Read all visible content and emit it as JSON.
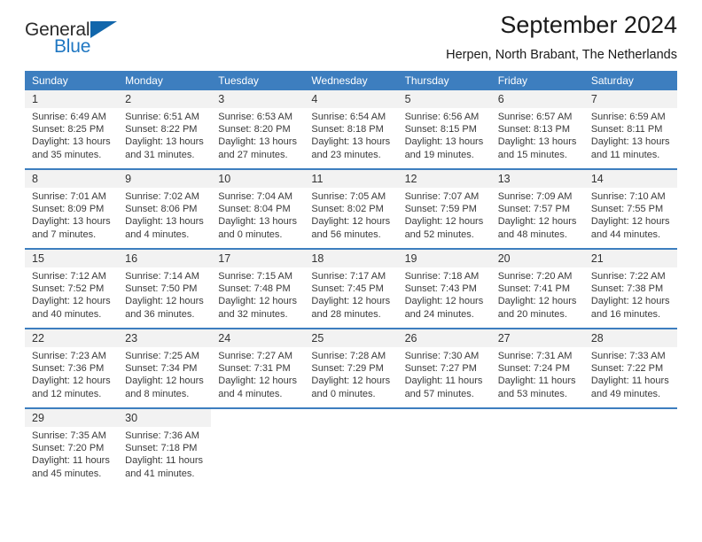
{
  "logo": {
    "word1": "General",
    "word2": "Blue",
    "triangle_color": "#1166ab",
    "blue_color": "#1f77c2"
  },
  "header": {
    "title": "September 2024",
    "subtitle": "Herpen, North Brabant, The Netherlands"
  },
  "theme": {
    "header_blue": "#3d7ebf",
    "day_number_band": "#f2f2f2",
    "text": "#3a3a3a"
  },
  "calendar": {
    "day_headers": [
      "Sunday",
      "Monday",
      "Tuesday",
      "Wednesday",
      "Thursday",
      "Friday",
      "Saturday"
    ],
    "weeks": [
      [
        {
          "day": "1",
          "sunrise": "Sunrise: 6:49 AM",
          "sunset": "Sunset: 8:25 PM",
          "daylight1": "Daylight: 13 hours",
          "daylight2": "and 35 minutes."
        },
        {
          "day": "2",
          "sunrise": "Sunrise: 6:51 AM",
          "sunset": "Sunset: 8:22 PM",
          "daylight1": "Daylight: 13 hours",
          "daylight2": "and 31 minutes."
        },
        {
          "day": "3",
          "sunrise": "Sunrise: 6:53 AM",
          "sunset": "Sunset: 8:20 PM",
          "daylight1": "Daylight: 13 hours",
          "daylight2": "and 27 minutes."
        },
        {
          "day": "4",
          "sunrise": "Sunrise: 6:54 AM",
          "sunset": "Sunset: 8:18 PM",
          "daylight1": "Daylight: 13 hours",
          "daylight2": "and 23 minutes."
        },
        {
          "day": "5",
          "sunrise": "Sunrise: 6:56 AM",
          "sunset": "Sunset: 8:15 PM",
          "daylight1": "Daylight: 13 hours",
          "daylight2": "and 19 minutes."
        },
        {
          "day": "6",
          "sunrise": "Sunrise: 6:57 AM",
          "sunset": "Sunset: 8:13 PM",
          "daylight1": "Daylight: 13 hours",
          "daylight2": "and 15 minutes."
        },
        {
          "day": "7",
          "sunrise": "Sunrise: 6:59 AM",
          "sunset": "Sunset: 8:11 PM",
          "daylight1": "Daylight: 13 hours",
          "daylight2": "and 11 minutes."
        }
      ],
      [
        {
          "day": "8",
          "sunrise": "Sunrise: 7:01 AM",
          "sunset": "Sunset: 8:09 PM",
          "daylight1": "Daylight: 13 hours",
          "daylight2": "and 7 minutes."
        },
        {
          "day": "9",
          "sunrise": "Sunrise: 7:02 AM",
          "sunset": "Sunset: 8:06 PM",
          "daylight1": "Daylight: 13 hours",
          "daylight2": "and 4 minutes."
        },
        {
          "day": "10",
          "sunrise": "Sunrise: 7:04 AM",
          "sunset": "Sunset: 8:04 PM",
          "daylight1": "Daylight: 13 hours",
          "daylight2": "and 0 minutes."
        },
        {
          "day": "11",
          "sunrise": "Sunrise: 7:05 AM",
          "sunset": "Sunset: 8:02 PM",
          "daylight1": "Daylight: 12 hours",
          "daylight2": "and 56 minutes."
        },
        {
          "day": "12",
          "sunrise": "Sunrise: 7:07 AM",
          "sunset": "Sunset: 7:59 PM",
          "daylight1": "Daylight: 12 hours",
          "daylight2": "and 52 minutes."
        },
        {
          "day": "13",
          "sunrise": "Sunrise: 7:09 AM",
          "sunset": "Sunset: 7:57 PM",
          "daylight1": "Daylight: 12 hours",
          "daylight2": "and 48 minutes."
        },
        {
          "day": "14",
          "sunrise": "Sunrise: 7:10 AM",
          "sunset": "Sunset: 7:55 PM",
          "daylight1": "Daylight: 12 hours",
          "daylight2": "and 44 minutes."
        }
      ],
      [
        {
          "day": "15",
          "sunrise": "Sunrise: 7:12 AM",
          "sunset": "Sunset: 7:52 PM",
          "daylight1": "Daylight: 12 hours",
          "daylight2": "and 40 minutes."
        },
        {
          "day": "16",
          "sunrise": "Sunrise: 7:14 AM",
          "sunset": "Sunset: 7:50 PM",
          "daylight1": "Daylight: 12 hours",
          "daylight2": "and 36 minutes."
        },
        {
          "day": "17",
          "sunrise": "Sunrise: 7:15 AM",
          "sunset": "Sunset: 7:48 PM",
          "daylight1": "Daylight: 12 hours",
          "daylight2": "and 32 minutes."
        },
        {
          "day": "18",
          "sunrise": "Sunrise: 7:17 AM",
          "sunset": "Sunset: 7:45 PM",
          "daylight1": "Daylight: 12 hours",
          "daylight2": "and 28 minutes."
        },
        {
          "day": "19",
          "sunrise": "Sunrise: 7:18 AM",
          "sunset": "Sunset: 7:43 PM",
          "daylight1": "Daylight: 12 hours",
          "daylight2": "and 24 minutes."
        },
        {
          "day": "20",
          "sunrise": "Sunrise: 7:20 AM",
          "sunset": "Sunset: 7:41 PM",
          "daylight1": "Daylight: 12 hours",
          "daylight2": "and 20 minutes."
        },
        {
          "day": "21",
          "sunrise": "Sunrise: 7:22 AM",
          "sunset": "Sunset: 7:38 PM",
          "daylight1": "Daylight: 12 hours",
          "daylight2": "and 16 minutes."
        }
      ],
      [
        {
          "day": "22",
          "sunrise": "Sunrise: 7:23 AM",
          "sunset": "Sunset: 7:36 PM",
          "daylight1": "Daylight: 12 hours",
          "daylight2": "and 12 minutes."
        },
        {
          "day": "23",
          "sunrise": "Sunrise: 7:25 AM",
          "sunset": "Sunset: 7:34 PM",
          "daylight1": "Daylight: 12 hours",
          "daylight2": "and 8 minutes."
        },
        {
          "day": "24",
          "sunrise": "Sunrise: 7:27 AM",
          "sunset": "Sunset: 7:31 PM",
          "daylight1": "Daylight: 12 hours",
          "daylight2": "and 4 minutes."
        },
        {
          "day": "25",
          "sunrise": "Sunrise: 7:28 AM",
          "sunset": "Sunset: 7:29 PM",
          "daylight1": "Daylight: 12 hours",
          "daylight2": "and 0 minutes."
        },
        {
          "day": "26",
          "sunrise": "Sunrise: 7:30 AM",
          "sunset": "Sunset: 7:27 PM",
          "daylight1": "Daylight: 11 hours",
          "daylight2": "and 57 minutes."
        },
        {
          "day": "27",
          "sunrise": "Sunrise: 7:31 AM",
          "sunset": "Sunset: 7:24 PM",
          "daylight1": "Daylight: 11 hours",
          "daylight2": "and 53 minutes."
        },
        {
          "day": "28",
          "sunrise": "Sunrise: 7:33 AM",
          "sunset": "Sunset: 7:22 PM",
          "daylight1": "Daylight: 11 hours",
          "daylight2": "and 49 minutes."
        }
      ],
      [
        {
          "day": "29",
          "sunrise": "Sunrise: 7:35 AM",
          "sunset": "Sunset: 7:20 PM",
          "daylight1": "Daylight: 11 hours",
          "daylight2": "and 45 minutes."
        },
        {
          "day": "30",
          "sunrise": "Sunrise: 7:36 AM",
          "sunset": "Sunset: 7:18 PM",
          "daylight1": "Daylight: 11 hours",
          "daylight2": "and 41 minutes."
        },
        {
          "day": "",
          "sunrise": "",
          "sunset": "",
          "daylight1": "",
          "daylight2": ""
        },
        {
          "day": "",
          "sunrise": "",
          "sunset": "",
          "daylight1": "",
          "daylight2": ""
        },
        {
          "day": "",
          "sunrise": "",
          "sunset": "",
          "daylight1": "",
          "daylight2": ""
        },
        {
          "day": "",
          "sunrise": "",
          "sunset": "",
          "daylight1": "",
          "daylight2": ""
        },
        {
          "day": "",
          "sunrise": "",
          "sunset": "",
          "daylight1": "",
          "daylight2": ""
        }
      ]
    ]
  }
}
